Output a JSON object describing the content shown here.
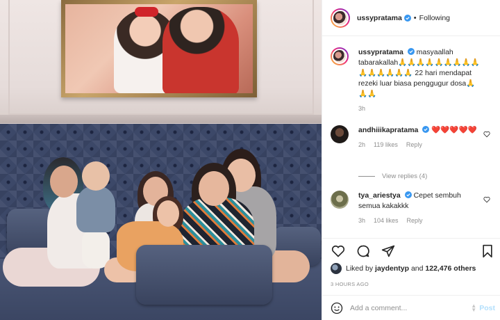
{
  "post": {
    "author": "ussypratama",
    "follow_status": "Following",
    "separator": "•",
    "caption": "masyaallah tabarakallah🙏🙏🙏🙏🙏🙏🙏🙏🙏🙏🙏🙏🙏🙏🙏 22 hari mendapat rezeki luar biasa penggugur dosa🙏🙏🙏",
    "caption_time": "3h",
    "liked_by_prefix": "Liked by ",
    "liked_by_user": "jaydentyp",
    "liked_by_and": " and ",
    "liked_by_count": "122,476 others",
    "time_ago": "3 HOURS AGO"
  },
  "comments": [
    {
      "author": "andhiiikapratama",
      "text": "❤️❤️❤️❤️❤️",
      "time": "2h",
      "likes": "119 likes",
      "reply": "Reply",
      "view_replies": "View replies (4)"
    },
    {
      "author": "tya_ariestya",
      "text": "Cepet sembuh semua kakakkk",
      "time": "3h",
      "likes": "104 likes",
      "reply": "Reply"
    }
  ],
  "comment_box": {
    "placeholder": "Add a comment...",
    "post_label": "Post"
  },
  "icons": {
    "like": "heart-icon",
    "comment": "comment-icon",
    "share": "share-icon",
    "save": "bookmark-icon",
    "emoji": "emoji-icon",
    "verified": "verified-badge-icon"
  },
  "colors": {
    "verified": "#3897f0",
    "link_muted": "#8e8e8e",
    "post_button": "#b2dffc",
    "heart_red": "#ed4956"
  }
}
